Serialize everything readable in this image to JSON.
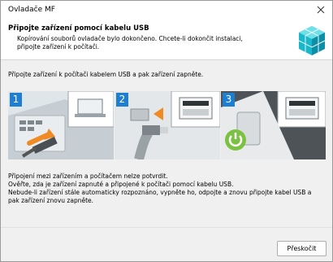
{
  "window": {
    "title": "Ovladače MF",
    "close_icon": "close-icon"
  },
  "header": {
    "title": "Připojte zařízení pomocí kabelu USB",
    "desc_line1": "Kopírování souborů ovladače bylo dokončeno. Chcete-li dokončit instalaci,",
    "desc_line2": "připojte zařízení k počítači.",
    "logo_icon": "installer-boxes-icon"
  },
  "instruction": "Připojte zařízení k počítači kabelem USB a pak zařízení zapněte.",
  "steps": [
    {
      "number": "1"
    },
    {
      "number": "2"
    },
    {
      "number": "3"
    }
  ],
  "notes": [
    "Připojení mezi zařízením a počítačem nelze potvrdit.",
    "Ověřte, zda je zařízení zapnuté a připojené k počítači pomocí kabelu USB.",
    "Nebude-li zařízení stále automaticky rozpoznáno, vypněte ho, odpojte a znovu připojte kabel USB a",
    "pak zařízení znovu zapněte."
  ],
  "footer": {
    "skip_label": "Přeskočit"
  },
  "colors": {
    "badge": "#1e7fd0",
    "power_green": "#7cc242",
    "arrow_orange": "#f08a24"
  }
}
